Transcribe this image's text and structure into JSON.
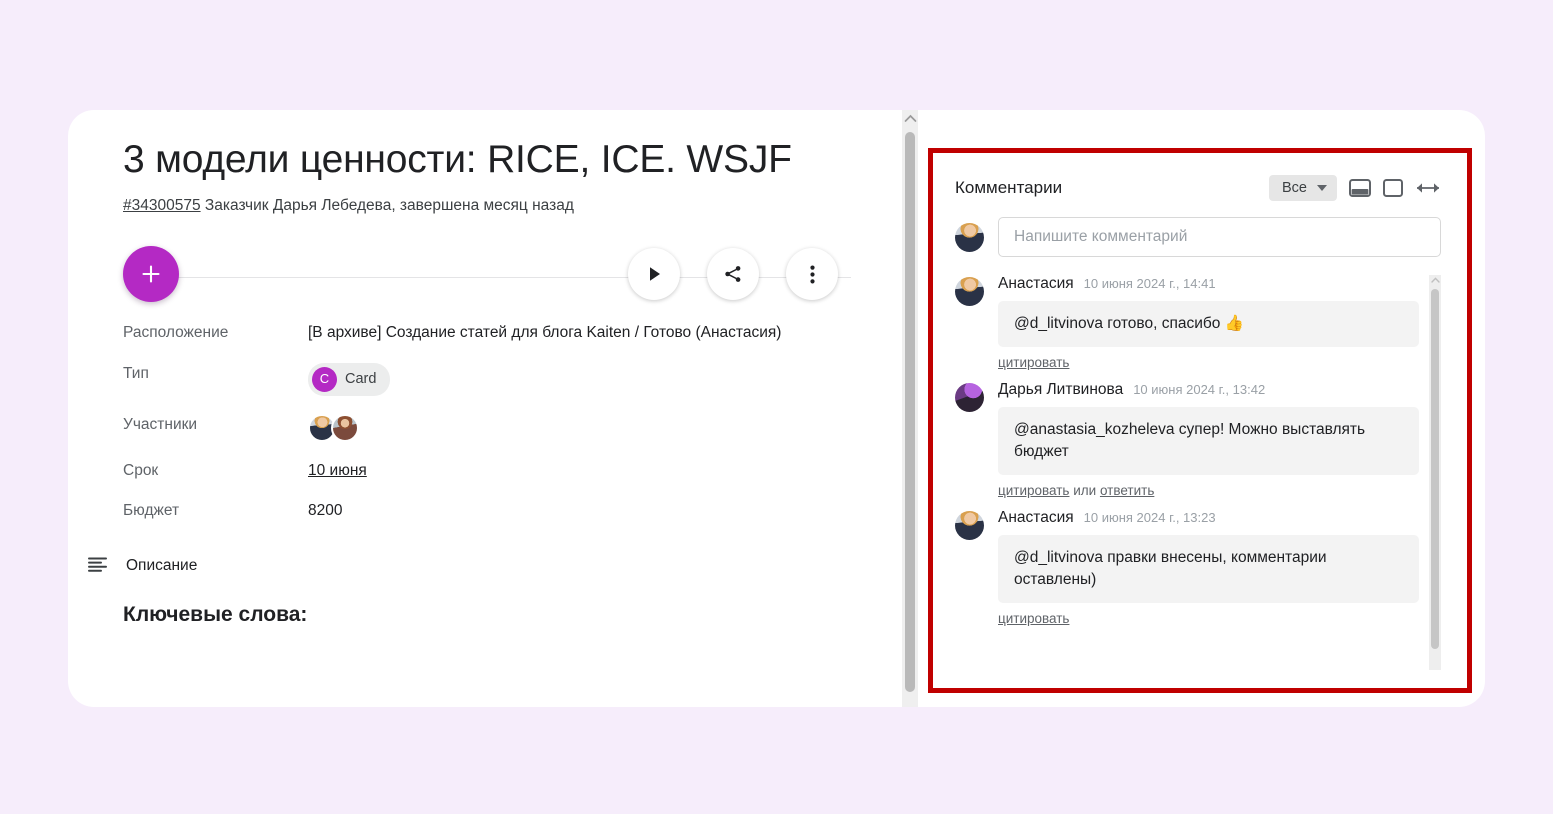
{
  "card": {
    "title": "3 модели ценности: RICE, ICE. WSJF",
    "card_id": "#34300575",
    "subtitle_rest": " Заказчик Дарья Лебедева, завершена месяц назад",
    "actions": {
      "add_label": "+",
      "play_icon": "play-icon",
      "share_icon": "share-icon",
      "more_icon": "more-vertical-icon"
    },
    "fields": [
      {
        "label": "Расположение",
        "value": "[В архиве] Создание статей для блога Kaiten / Готово (Анастасия)",
        "type": "text"
      },
      {
        "label": "Тип",
        "value": "Card",
        "badge": "C",
        "type": "chip"
      },
      {
        "label": "Участники",
        "value": "",
        "type": "avatars"
      },
      {
        "label": "Срок",
        "value": "10 июня",
        "type": "link"
      },
      {
        "label": "Бюджет",
        "value": "8200",
        "type": "text"
      }
    ],
    "description": {
      "icon": "description-lines-icon",
      "title": "Описание",
      "body": "Ключевые слова:"
    }
  },
  "comments": {
    "title": "Комментарии",
    "filter": {
      "label": "Все",
      "caret_icon": "chevron-down-icon"
    },
    "tools": [
      {
        "name": "layout-bottom-icon"
      },
      {
        "name": "layout-square-icon"
      },
      {
        "name": "resize-horizontal-icon"
      }
    ],
    "composer": {
      "placeholder": "Напишите комментарий",
      "value": ""
    },
    "items": [
      {
        "author": "Анастасия",
        "time": "10 июня 2024 г., 14:41",
        "text": "@d_litvinova готово, спасибо 👍",
        "actions": {
          "quote": "цитировать",
          "separator": "",
          "reply": ""
        },
        "avatar": "av-anastasia"
      },
      {
        "author": "Дарья Литвинова",
        "time": "10 июня 2024 г., 13:42",
        "text": "@anastasia_kozheleva супер! Можно выставлять бюджет",
        "actions": {
          "quote": "цитировать",
          "separator": " или ",
          "reply": "ответить"
        },
        "avatar": "av-darya-purple"
      },
      {
        "author": "Анастасия",
        "time": "10 июня 2024 г., 13:23",
        "text": "@d_litvinova правки внесены, комментарии оставлены)",
        "actions": {
          "quote": "цитировать",
          "separator": "",
          "reply": ""
        },
        "avatar": "av-anastasia"
      }
    ]
  },
  "colors": {
    "page_background": "#f6edfb",
    "accent_purple": "#b429c4",
    "highlight_red": "#c00000",
    "bubble_gray": "#f3f3f3"
  }
}
